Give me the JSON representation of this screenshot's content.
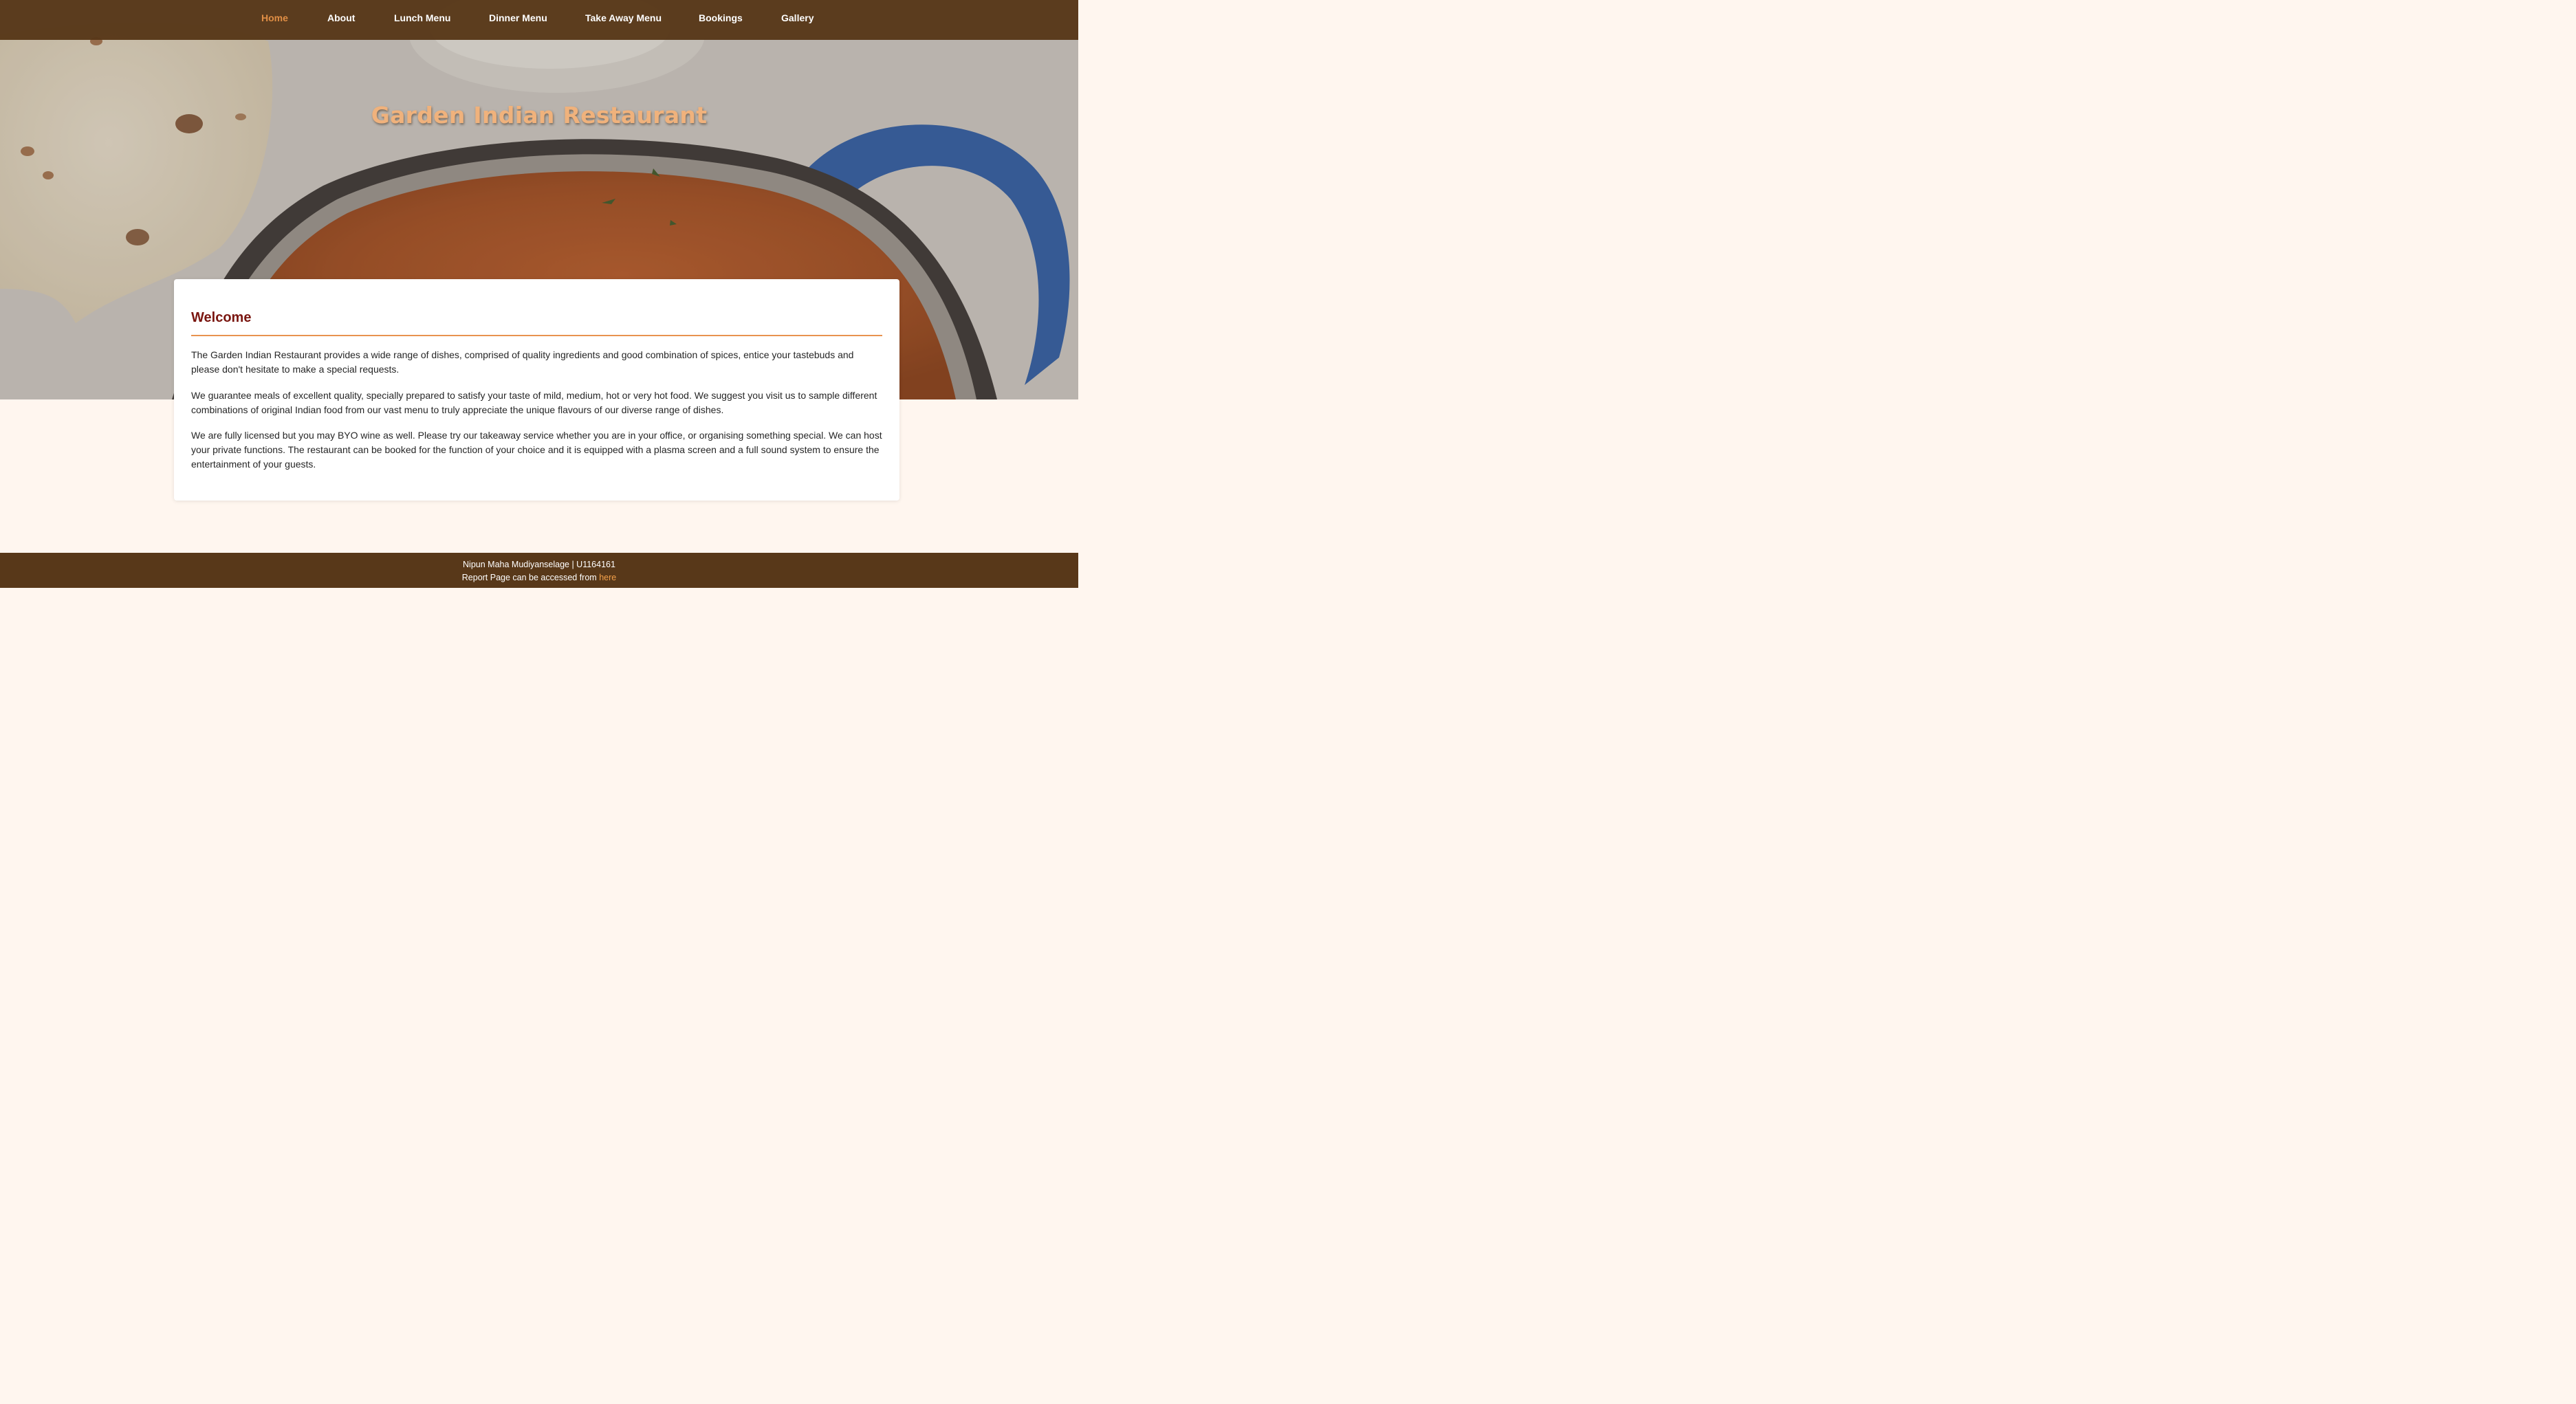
{
  "nav": {
    "items": [
      {
        "label": "Home",
        "active": true
      },
      {
        "label": "About",
        "active": false
      },
      {
        "label": "Lunch Menu",
        "active": false
      },
      {
        "label": "Dinner Menu",
        "active": false
      },
      {
        "label": "Take Away Menu",
        "active": false
      },
      {
        "label": "Bookings",
        "active": false
      },
      {
        "label": "Gallery",
        "active": false
      }
    ]
  },
  "hero": {
    "title": "Garden Indian Restaurant"
  },
  "welcome": {
    "heading": "Welcome",
    "paragraphs": [
      "The Garden Indian Restaurant provides a wide range of dishes, comprised of quality ingredients and good combination of spices, entice your tastebuds and please don't hesitate to make a special requests.",
      "We guarantee meals of excellent quality, specially prepared to satisfy your taste of mild, medium, hot or very hot food. We suggest you visit us to sample different combinations of original Indian food from our vast menu to truly appreciate the unique flavours of our diverse range of dishes.",
      "We are fully licensed but you may BYO wine as well. Please try our takeaway service whether you are in your office, or organising something special. We can host your private functions. The restaurant can be booked for the function of your choice and it is equipped with a plasma screen and a full sound system to ensure the entertainment of your guests."
    ]
  },
  "footer": {
    "credit": "Nipun Maha Mudiyanselage | U1164161",
    "report_text": "Report Page can be accessed from ",
    "report_link": "here"
  },
  "colors": {
    "nav_bg": "#583819",
    "accent": "#e08e45",
    "title": "#f0b27c",
    "heading": "#7a1610",
    "page_bg": "#fff6ef"
  }
}
